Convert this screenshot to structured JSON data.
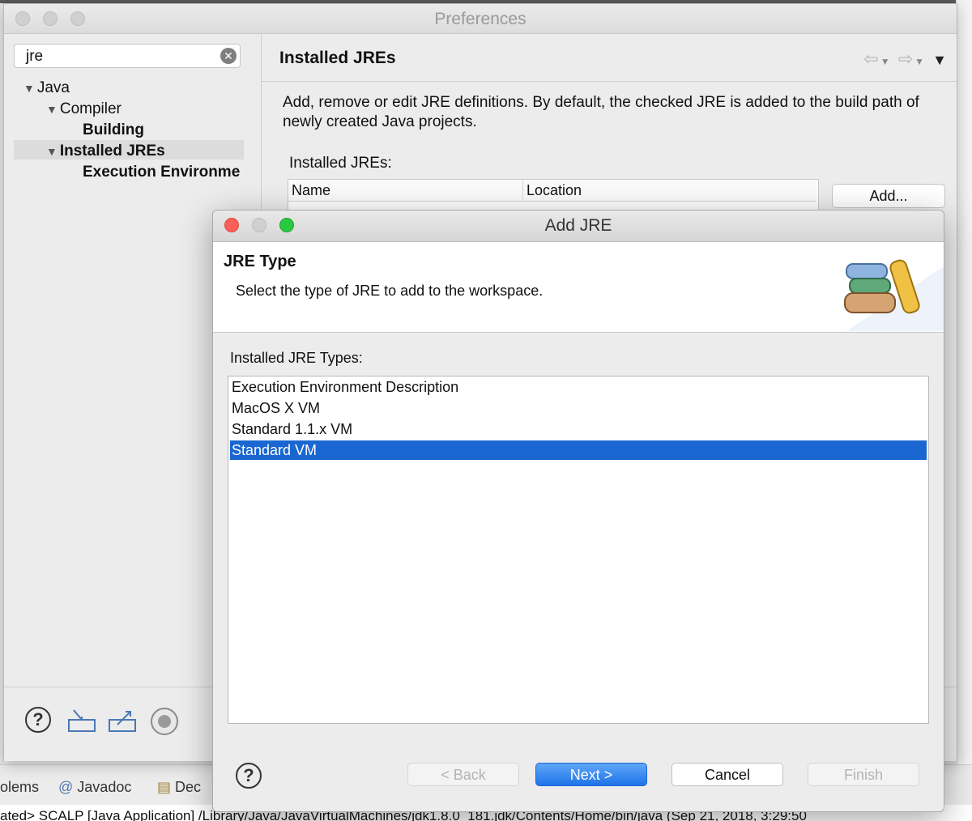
{
  "background": {
    "tabs": [
      "olems",
      "Javadoc",
      "Dec"
    ],
    "console_line": "ated> SCALP [Java Application] /Library/Java/JavaVirtualMachines/jdk1.8.0_181.jdk/Contents/Home/bin/java (Sep 21, 2018, 3:29:50"
  },
  "preferences": {
    "title": "Preferences",
    "filter_value": "jre",
    "tree": [
      {
        "label": "Java",
        "expanded": true
      },
      {
        "label": "Compiler",
        "expanded": true
      },
      {
        "label": "Building"
      },
      {
        "label": "Installed JREs",
        "expanded": true,
        "selected": true
      },
      {
        "label": "Execution Environme"
      }
    ],
    "page_title": "Installed JREs",
    "description": "Add, remove or edit JRE definitions. By default, the checked JRE is added to the build path of newly created Java projects.",
    "installed_label": "Installed JREs:",
    "table_headers": [
      "Name",
      "Location"
    ],
    "add_button": "Add..."
  },
  "dialog": {
    "title": "Add JRE",
    "header_title": "JRE Type",
    "header_message": "Select the type of JRE to add to the workspace.",
    "types_label": "Installed JRE Types:",
    "types": [
      {
        "label": "Execution Environment Description",
        "selected": false
      },
      {
        "label": "MacOS X VM",
        "selected": false
      },
      {
        "label": "Standard 1.1.x VM",
        "selected": false
      },
      {
        "label": "Standard VM",
        "selected": true
      }
    ],
    "buttons": {
      "back": "< Back",
      "next": "Next >",
      "cancel": "Cancel",
      "finish": "Finish"
    }
  },
  "colors": {
    "selection": "#1a67d2",
    "close": "#fc5f57",
    "minimize": "#fdbc2e",
    "zoom": "#28c940"
  }
}
